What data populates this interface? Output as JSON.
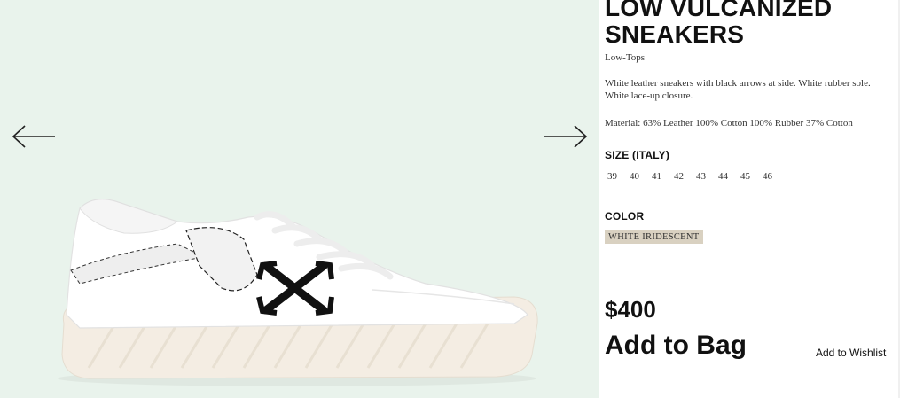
{
  "product": {
    "title_line1": "LOW VULCANIZED",
    "title_line2": "SNEAKERS",
    "category": "Low-Tops",
    "description": "White leather sneakers with black arrows at side. White rubber sole. White lace-up closure.",
    "material": "Material: 63% Leather 100% Cotton 100% Rubber 37% Cotton",
    "size_heading": "SIZE (ITALY)",
    "sizes": [
      "39",
      "40",
      "41",
      "42",
      "43",
      "44",
      "45",
      "46"
    ],
    "color_heading": "COLOR",
    "color_value": "WHITE IRIDESCENT",
    "price": "$400",
    "add_to_bag": "Add to Bag",
    "add_to_wishlist": "Add to Wishlist"
  },
  "gallery": {
    "prev_icon": "arrow-left-icon",
    "next_icon": "arrow-right-icon",
    "image": "white-sneaker-with-black-arrow"
  },
  "colors": {
    "gallery_bg": "#e9f3ec",
    "swatch_bg": "#d9d1c1"
  }
}
